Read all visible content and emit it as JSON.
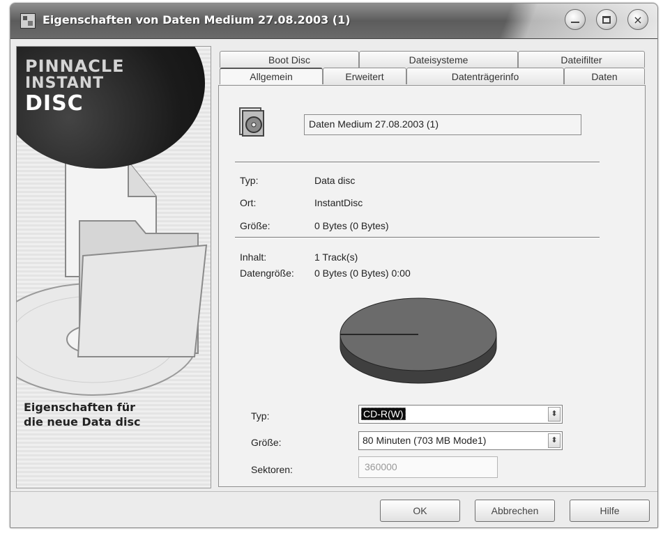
{
  "window": {
    "title": "Eigenschaften von Daten Medium 27.08.2003 (1)",
    "controls": {
      "minimize": "minimize-icon",
      "maximize": "maximize-icon",
      "close": "×"
    }
  },
  "banner": {
    "logo": [
      "PINNACLE",
      "INSTANT",
      "DISC"
    ],
    "caption": [
      "Eigenschaften für",
      "die neue Data disc"
    ]
  },
  "tabs": {
    "row1": [
      "Boot Disc",
      "Dateisysteme",
      "Dateifilter"
    ],
    "row2": [
      "Allgemein",
      "Erweitert",
      "Datenträgerinfo",
      "Daten"
    ],
    "active": "Allgemein"
  },
  "general": {
    "name": "Daten Medium 27.08.2003 (1)",
    "type_label": "Typ:",
    "type_value": "Data disc",
    "location_label": "Ort:",
    "location_value": "InstantDisc",
    "size_label": "Größe:",
    "size_value": "0 Bytes (0 Bytes)",
    "content_label": "Inhalt:",
    "content_value": "1 Track(s)",
    "datasize_label": "Datengröße:",
    "datasize_value": "0 Bytes (0 Bytes) 0:00"
  },
  "media": {
    "type_label": "Typ:",
    "type_value": "CD-R(W)",
    "size_label": "Größe:",
    "size_value": "80 Minuten (703 MB Mode1)",
    "sectors_label": "Sektoren:",
    "sectors_value": "360000",
    "used_fraction": 0
  },
  "buttons": {
    "ok": "OK",
    "cancel": "Abbrechen",
    "help": "Hilfe"
  },
  "colors": {
    "pie_fill": "#6b6b6b",
    "pie_side": "#3f3f3f",
    "titlebar": "#6a6a6a"
  }
}
